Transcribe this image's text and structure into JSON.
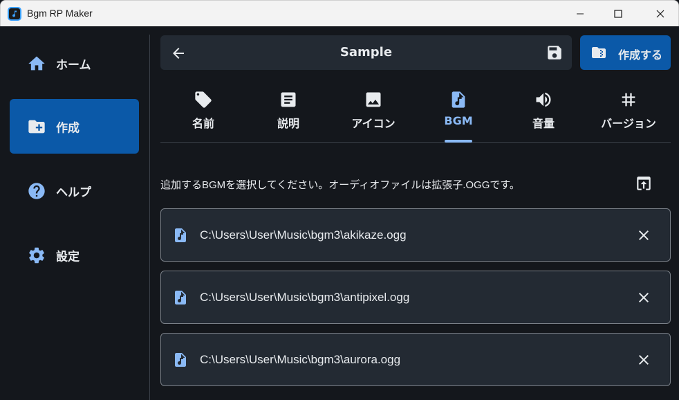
{
  "window": {
    "title": "Bgm RP Maker"
  },
  "sidebar": {
    "items": [
      {
        "label": "ホーム",
        "icon": "home-icon"
      },
      {
        "label": "作成",
        "icon": "folder-add-icon",
        "active": true
      },
      {
        "label": "ヘルプ",
        "icon": "help-icon"
      },
      {
        "label": "設定",
        "icon": "gear-icon"
      }
    ]
  },
  "header": {
    "title": "Sample"
  },
  "create_button": {
    "label": "作成する"
  },
  "tabs": [
    {
      "label": "名前",
      "icon": "tag-icon"
    },
    {
      "label": "説明",
      "icon": "description-icon"
    },
    {
      "label": "アイコン",
      "icon": "image-icon"
    },
    {
      "label": "BGM",
      "icon": "music-file-icon",
      "active": true
    },
    {
      "label": "音量",
      "icon": "volume-icon"
    },
    {
      "label": "バージョン",
      "icon": "hash-icon"
    }
  ],
  "bgm": {
    "description": "追加するBGMを選択してください。オーディオファイルは拡張子.OGGです。",
    "files": [
      "C:\\Users\\User\\Music\\bgm3\\akikaze.ogg",
      "C:\\Users\\User\\Music\\bgm3\\antipixel.ogg",
      "C:\\Users\\User\\Music\\bgm3\\aurora.ogg"
    ]
  },
  "colors": {
    "background": "#14171c",
    "surface": "#232a33",
    "accent": "#0b59a8",
    "active_tab": "#8ab9f5",
    "icon_blue": "#8ab9f5"
  }
}
